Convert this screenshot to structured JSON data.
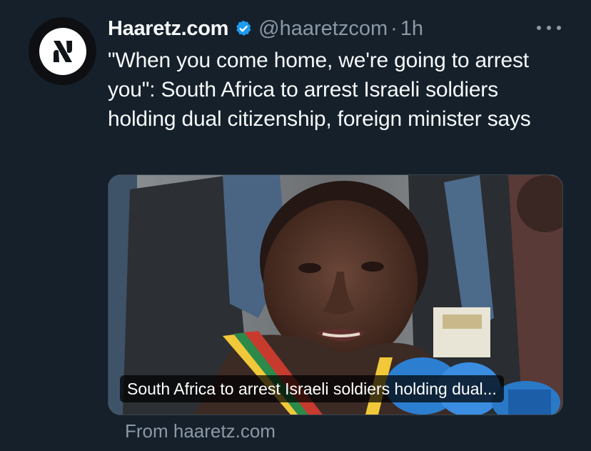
{
  "tweet": {
    "author": {
      "display_name": "Haaretz.com",
      "handle": "@haaretzcom",
      "verified": true,
      "avatar_icon": "haaretz-logo-icon"
    },
    "separator": "·",
    "time": "1h",
    "text": "\"When you come home, we're going to arrest you\": South Africa to arrest Israeli soldiers holding dual citizenship, foreign minister says",
    "more_icon": "more-dots-icon"
  },
  "card": {
    "image_icon": "news-photo-image",
    "caption": "South Africa to arrest Israeli soldiers holding dual...",
    "source": "From haaretz.com"
  },
  "colors": {
    "background": "#15202b",
    "text": "#f7f9f9",
    "secondary": "#8b98a5",
    "verified_blue": "#1d9bf0"
  }
}
